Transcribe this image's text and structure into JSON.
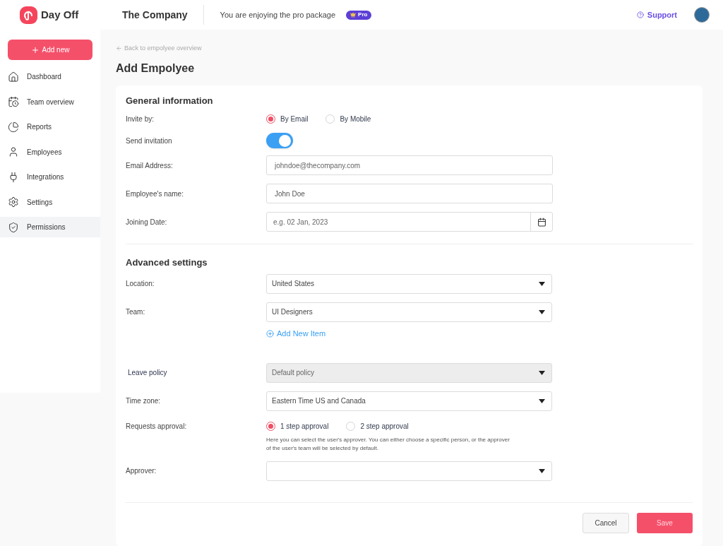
{
  "brand": {
    "name": "Day Off"
  },
  "header": {
    "company": "The Company",
    "package_text": "You are enjoying the pro package",
    "badge": "Pro",
    "support": "Support"
  },
  "sidebar": {
    "add_button": "Add new",
    "items": [
      {
        "label": "Dashboard",
        "selected": false
      },
      {
        "label": "Team overview",
        "selected": false
      },
      {
        "label": "Reports",
        "selected": false
      },
      {
        "label": "Employees",
        "selected": false
      },
      {
        "label": "Integrations",
        "selected": false
      },
      {
        "label": "Settings",
        "selected": false
      },
      {
        "label": "Permissions",
        "selected": true
      }
    ]
  },
  "back_link": "Back to empolyee overview",
  "page_title": "Add Empolyee",
  "sections": [
    {
      "title": "General information",
      "rows": [
        {
          "kind": "radio",
          "label": "Invite by:",
          "options": [
            {
              "label": "By Email",
              "selected": true
            },
            {
              "label": "By Mobile",
              "selected": false
            }
          ]
        },
        {
          "kind": "toggle",
          "label": "Send invitation",
          "on": true
        },
        {
          "kind": "input",
          "label": "Email Address:",
          "placeholder": "johndoe@thecompany.com"
        },
        {
          "kind": "input",
          "label": "Employee's name:",
          "value": "John Doe"
        },
        {
          "kind": "date",
          "label": "Joining Date:",
          "placeholder": "e.g. 02 Jan, 2023"
        }
      ]
    },
    {
      "title": "Advanced settings",
      "rows": [
        {
          "kind": "select",
          "label": "Location:",
          "value": "United States",
          "disabled": false
        },
        {
          "kind": "select",
          "label": "Team:",
          "value": "UI Designers",
          "disabled": false
        },
        {
          "kind": "link",
          "text": "Add New Item"
        },
        {
          "kind": "select",
          "label": "Leave policy",
          "value": "Default policy",
          "disabled": true
        },
        {
          "kind": "select",
          "label": "Time zone:",
          "value": "Eastern Time US and Canada",
          "disabled": false
        },
        {
          "kind": "radio",
          "label": "Requests approval:",
          "options": [
            {
              "label": "1 step approval",
              "selected": true
            },
            {
              "label": "2 step approval",
              "selected": false
            }
          ],
          "help": "Here you can select the user's approver. You can either choose a specific person, or the approver of the user's team will be selected by default."
        },
        {
          "kind": "select",
          "label": "Approver:",
          "value": "",
          "disabled": false
        }
      ]
    }
  ],
  "buttons": {
    "cancel": "Cancel",
    "save": "Save"
  }
}
